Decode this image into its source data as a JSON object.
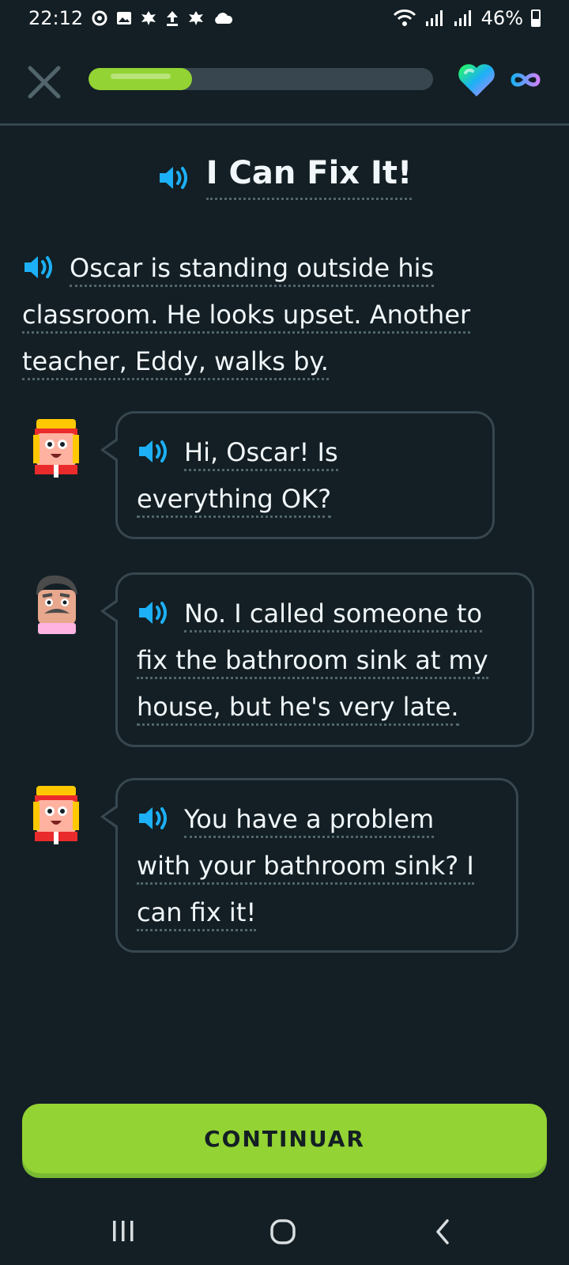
{
  "status_bar": {
    "time": "22:12",
    "battery": "46%",
    "left_icons": [
      "settings-icon",
      "image-icon",
      "leaf-icon",
      "upload-icon",
      "leaf-icon",
      "cloud-icon"
    ],
    "right_icons": [
      "wifi-icon",
      "signal-icon",
      "signal-icon",
      "battery-icon"
    ]
  },
  "header": {
    "progress_fraction": 0.3,
    "colors": {
      "progress": "#93d333",
      "track": "#37464f",
      "accent_blue": "#1cb0f6"
    }
  },
  "story": {
    "title": "I Can Fix It!",
    "narration": "Oscar is standing outside his classroom. He looks upset. Another teacher, Eddy, walks by."
  },
  "dialogue": [
    {
      "speaker_avatar": "eddy-avatar",
      "text": "Hi, Oscar! Is everything OK?"
    },
    {
      "speaker_avatar": "oscar-avatar",
      "text": "No. I called someone to fix the bathroom sink at my house, but he's very late."
    },
    {
      "speaker_avatar": "eddy-avatar",
      "text": "You have a problem with your bathroom sink? I can fix it!"
    }
  ],
  "footer": {
    "continue_label": "CONTINUAR"
  }
}
